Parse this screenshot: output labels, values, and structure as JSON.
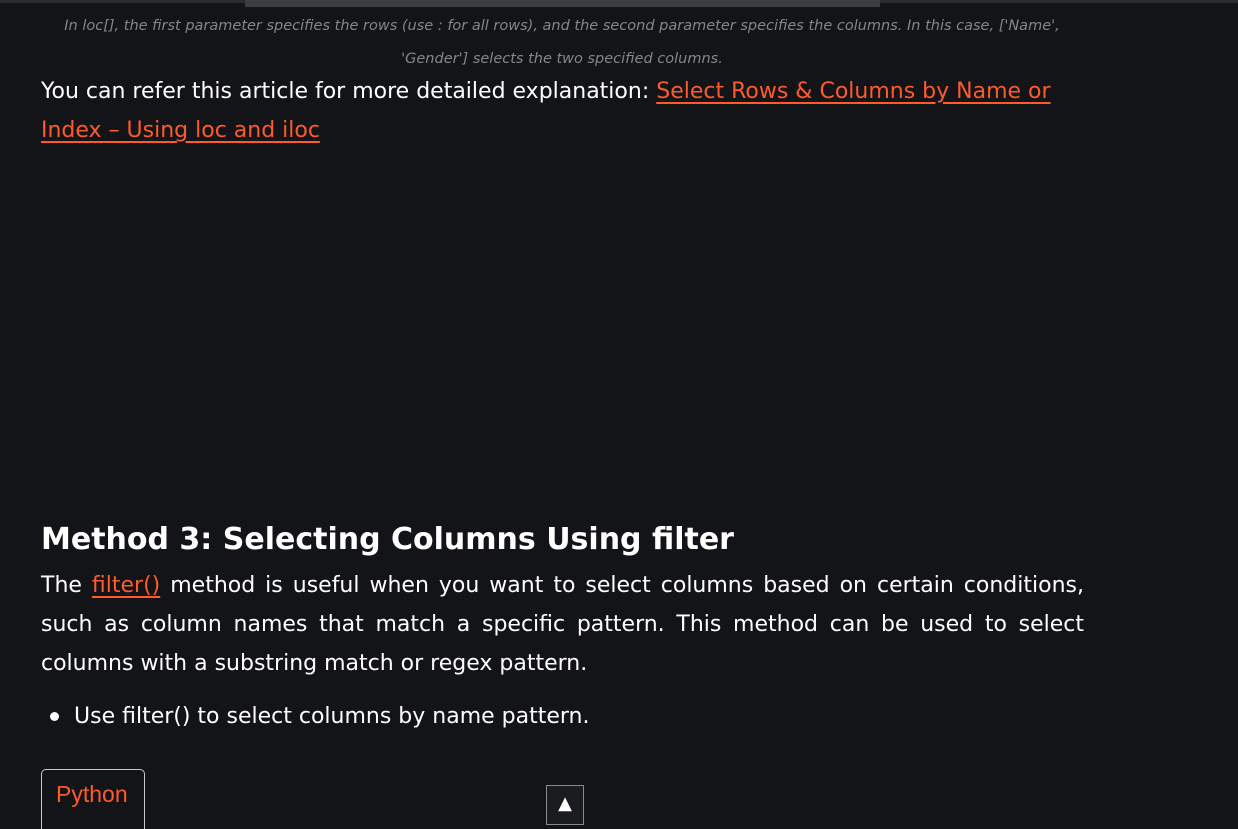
{
  "caption": {
    "text": "In loc[], the first parameter specifies the rows (use : for all rows), and the second parameter specifies the columns. In this case, ['Name', 'Gender'] selects the two specified columns."
  },
  "reference": {
    "prefix": "You can refer this article for more detailed explanation: ",
    "link_text": "Select Rows & Columns by Name or Index – Using loc and iloc"
  },
  "section": {
    "heading": "Method 3: Selecting Columns Using filter",
    "intro_before": "The ",
    "intro_link": "filter()",
    "intro_after": " method is useful when you want to select columns based on certain conditions, such as column names that match a specific pattern. This method can be used to select columns with a substring match or regex pattern.",
    "bullets": [
      "Use filter() to select columns by name pattern."
    ]
  },
  "code_block": {
    "language_tab": "Python"
  },
  "scroll_top": {
    "icon": "▲"
  }
}
